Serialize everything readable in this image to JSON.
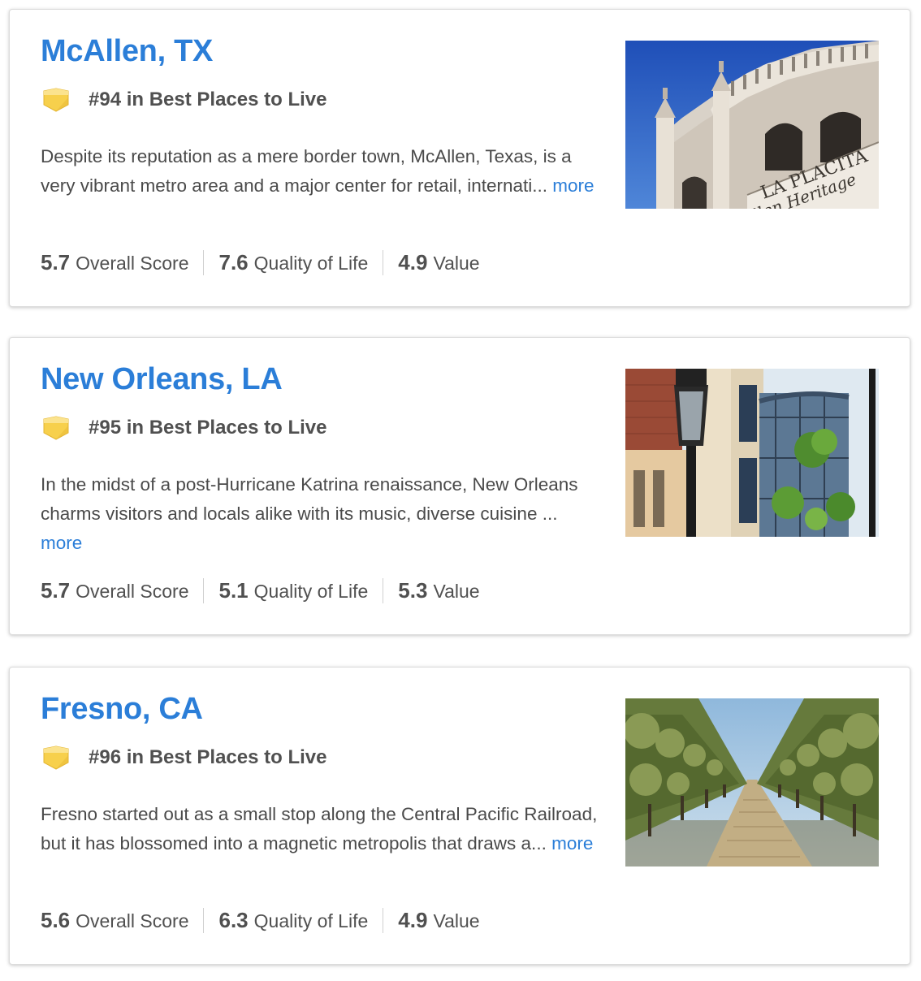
{
  "cards": [
    {
      "city": "McAllen, TX",
      "rank": "#94 in Best Places to Live",
      "description": "Despite its reputation as a mere border town, McAllen, Texas, is a very vibrant metro area and a major center for retail, internati...",
      "more": "more",
      "scores": [
        {
          "value": "5.7",
          "label": "Overall Score"
        },
        {
          "value": "7.6",
          "label": "Quality of Life"
        },
        {
          "value": "4.9",
          "label": "Value"
        }
      ],
      "photo_text": [
        "LA PLACITA",
        "llen Heritage"
      ]
    },
    {
      "city": "New Orleans, LA",
      "rank": "#95 in Best Places to Live",
      "description": "In the midst of a post-Hurricane Katrina renaissance, New Orleans charms visitors and locals alike with its music, diverse cuisine ...",
      "more": "more",
      "scores": [
        {
          "value": "5.7",
          "label": "Overall Score"
        },
        {
          "value": "5.1",
          "label": "Quality of Life"
        },
        {
          "value": "5.3",
          "label": "Value"
        }
      ]
    },
    {
      "city": "Fresno, CA",
      "rank": "#96 in Best Places to Live",
      "description": "Fresno started out as a small stop along the Central Pacific Railroad, but it has blossomed into a magnetic metropolis that draws a...",
      "more": "more",
      "scores": [
        {
          "value": "5.6",
          "label": "Overall Score"
        },
        {
          "value": "6.3",
          "label": "Quality of Life"
        },
        {
          "value": "4.9",
          "label": "Value"
        }
      ]
    }
  ],
  "colors": {
    "link": "#2b7ed8",
    "text": "#4a4a4a",
    "badge": "#f7d04c"
  }
}
